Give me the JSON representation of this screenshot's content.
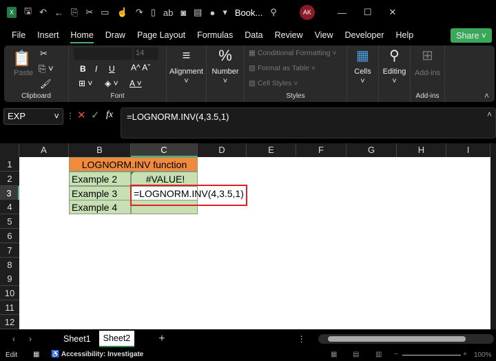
{
  "titlebar": {
    "title": "Book...",
    "user_initials": "AK"
  },
  "menu": {
    "items": [
      "File",
      "Insert",
      "Home",
      "Draw",
      "Page Layout",
      "Formulas",
      "Data",
      "Review",
      "View",
      "Developer",
      "Help"
    ],
    "active": "Home",
    "share": "Share"
  },
  "ribbon": {
    "paste": "Paste",
    "clipboard": "Clipboard",
    "font_size": "14",
    "font": "Font",
    "bold": "B",
    "italic": "I",
    "underline": "U",
    "alignment": "Alignment",
    "number": "Number",
    "conditional_formatting": "Conditional Formatting",
    "format_as_table": "Format as Table",
    "cell_styles": "Cell Styles",
    "styles": "Styles",
    "cells": "Cells",
    "editing": "Editing",
    "addins_btn": "Add-ins",
    "addins": "Add-ins"
  },
  "formula_bar": {
    "name_box": "EXP",
    "fx": "fx",
    "formula": "=LOGNORM.INV(4,3.5,1)"
  },
  "columns": [
    "A",
    "B",
    "C",
    "D",
    "E",
    "F",
    "G",
    "H",
    "I"
  ],
  "rows": [
    "1",
    "2",
    "3",
    "4",
    "5",
    "6",
    "7",
    "8",
    "9",
    "10",
    "11",
    "12"
  ],
  "cells": {
    "B1": "LOGNORM.INV function",
    "B2": "Example 2",
    "C2": "#VALUE!",
    "B3": "Example 3",
    "C3": "=LOGNORM.INV(4,3.5,1)",
    "B4": "Example 4"
  },
  "colors": {
    "header_fill": "#f08a3c",
    "data_fill": "#c6e0b4",
    "highlight_box": "#e02020"
  },
  "sheets": {
    "tabs": [
      "Sheet1",
      "Sheet2"
    ],
    "active": "Sheet2"
  },
  "status": {
    "mode": "Edit",
    "accessibility": "Accessibility: Investigate",
    "zoom": "100%"
  }
}
